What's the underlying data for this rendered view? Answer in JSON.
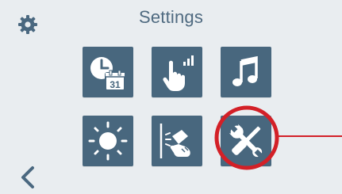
{
  "header": {
    "title": "Settings",
    "settings_icon": "gear-icon"
  },
  "tiles": [
    {
      "icon": "clock-calendar-icon",
      "calendar_day": "31"
    },
    {
      "icon": "touch-signal-icon"
    },
    {
      "icon": "music-note-icon"
    },
    {
      "icon": "brightness-icon"
    },
    {
      "icon": "screen-cleaning-icon"
    },
    {
      "icon": "tools-icon",
      "highlighted": true
    }
  ],
  "footer": {
    "back_icon": "chevron-left-icon"
  },
  "annotation": {
    "circle_color": "#d32027"
  }
}
